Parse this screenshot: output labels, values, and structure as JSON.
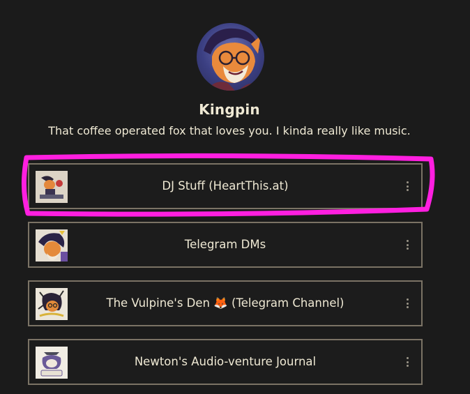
{
  "profile": {
    "name": "Kingpin",
    "bio": "That coffee operated fox that loves you. I kinda really like music."
  },
  "links": [
    {
      "label": "DJ Stuff (HeartThis.at)"
    },
    {
      "label": "Telegram DMs"
    },
    {
      "label": "The Vulpine's Den 🦊 (Telegram Channel)"
    },
    {
      "label": "Newton's Audio-venture Journal"
    }
  ],
  "colors": {
    "background": "#1b1b1b",
    "card_border": "#7b7365",
    "text": "#efe9d4",
    "highlight": "#ff1fe0"
  },
  "icons": {
    "link_menu": "vertical-dots-icon"
  }
}
